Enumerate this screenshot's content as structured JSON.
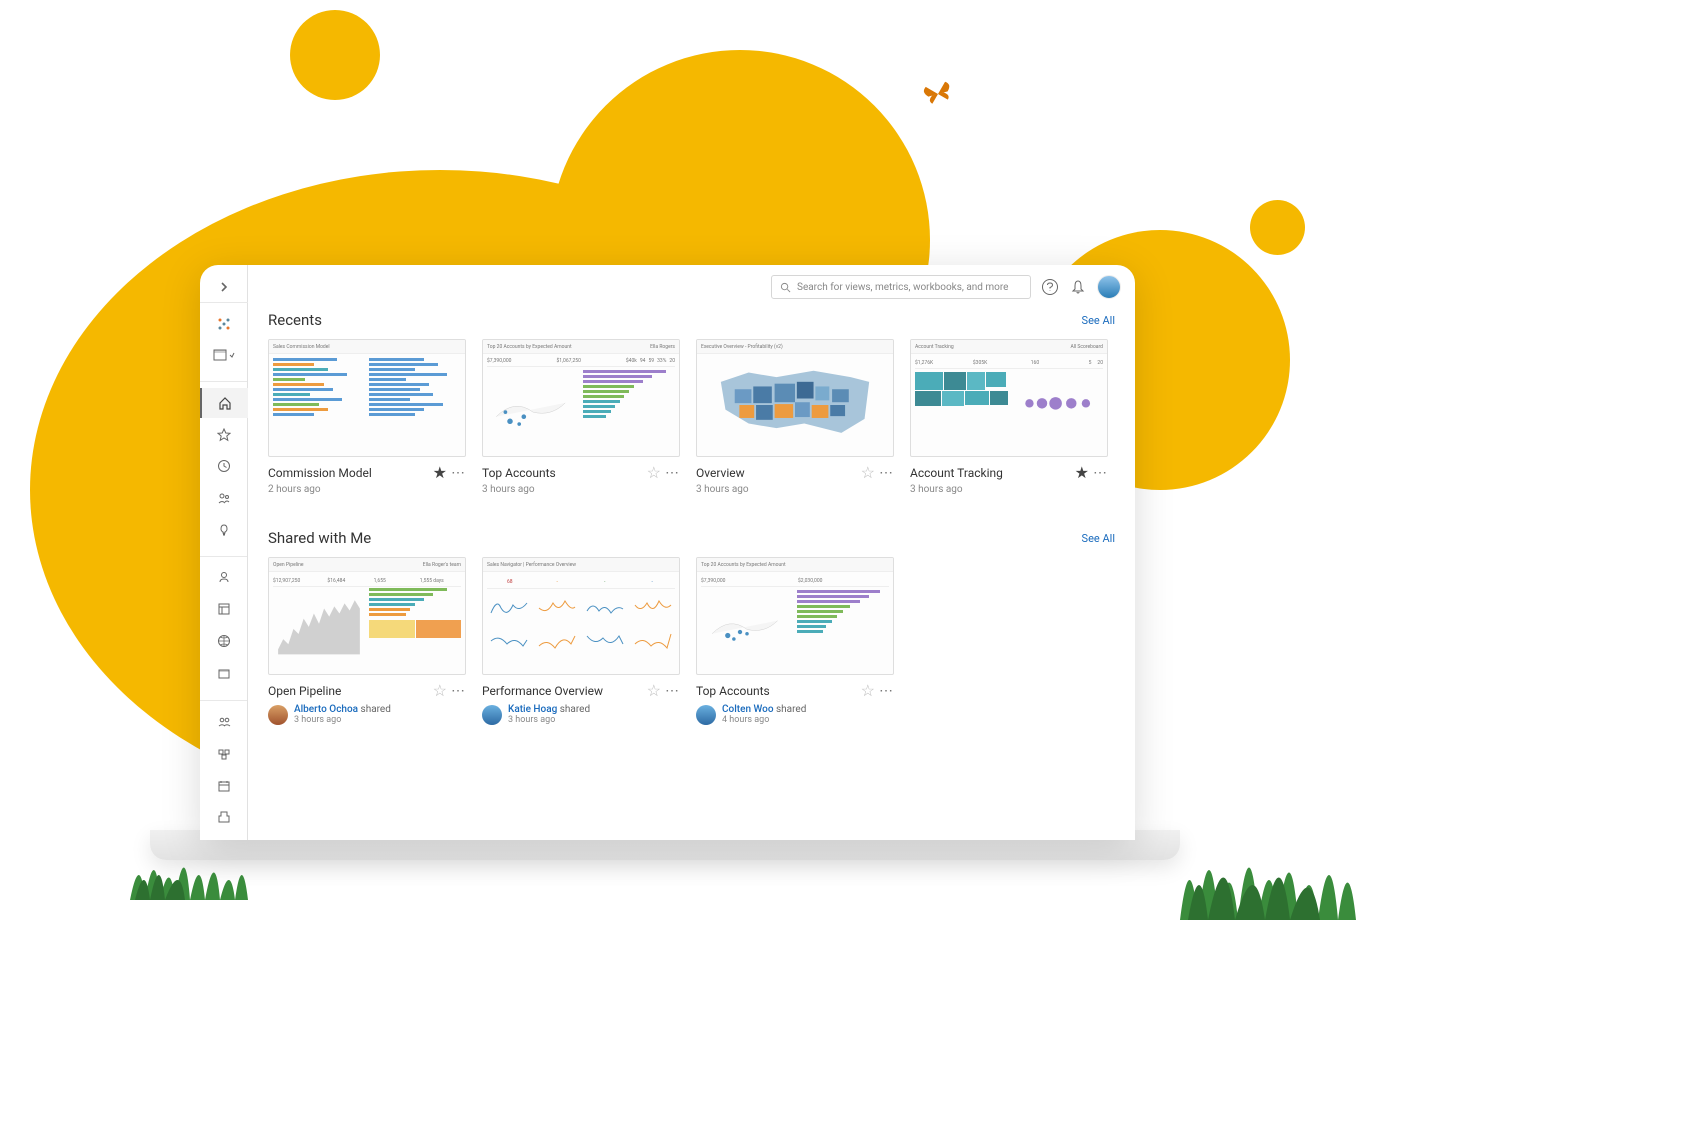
{
  "search": {
    "placeholder": "Search for views, metrics, workbooks, and more"
  },
  "sections": {
    "recents": {
      "title": "Recents",
      "see_all": "See All"
    },
    "shared": {
      "title": "Shared with Me",
      "see_all": "See All"
    }
  },
  "recents": [
    {
      "title": "Commission Model",
      "time": "2 hours ago",
      "starred": true,
      "thumb_label": "Sales Commission Model"
    },
    {
      "title": "Top Accounts",
      "time": "3 hours ago",
      "starred": false,
      "thumb_label": "Top 20 Accounts by Expected Amount",
      "thumb_right": "Ella Rogers",
      "stat1": "$7,390,000",
      "stat2": "$1,067,250",
      "stat3": "$40k",
      "stat4": "94",
      "stat5": "59",
      "stat6": "33%",
      "stat7": "20"
    },
    {
      "title": "Overview",
      "time": "3 hours ago",
      "starred": false,
      "thumb_label": "Executive Overview - Profitability (v2)"
    },
    {
      "title": "Account Tracking",
      "time": "3 hours ago",
      "starred": true,
      "thumb_label": "Account Tracking",
      "thumb_right": "All Scoreboard",
      "stat1": "$1,276K",
      "stat2": "$305K",
      "stat3": "160",
      "stat4": "5",
      "stat5": "20"
    }
  ],
  "shared": [
    {
      "title": "Open Pipeline",
      "starred": false,
      "shared_by": "Alberto Ochoa",
      "action": "shared",
      "time": "3 hours ago",
      "thumb_label": "Open Pipeline",
      "thumb_right": "Ella Roger's team",
      "stat1": "$12,907,250",
      "stat2": "$16,484",
      "stat3": "1,655",
      "stat4": "1,555 days"
    },
    {
      "title": "Performance Overview",
      "starred": false,
      "shared_by": "Katie Hoag",
      "action": "shared",
      "time": "3 hours ago",
      "thumb_label": "Sales Navigator | Performance Overview"
    },
    {
      "title": "Top Accounts",
      "starred": false,
      "shared_by": "Colten Woo",
      "action": "shared",
      "time": "4 hours ago",
      "thumb_label": "Top 20 Accounts by Expected Amount",
      "stat1": "$7,390,000",
      "stat2": "$2,030,000"
    }
  ]
}
